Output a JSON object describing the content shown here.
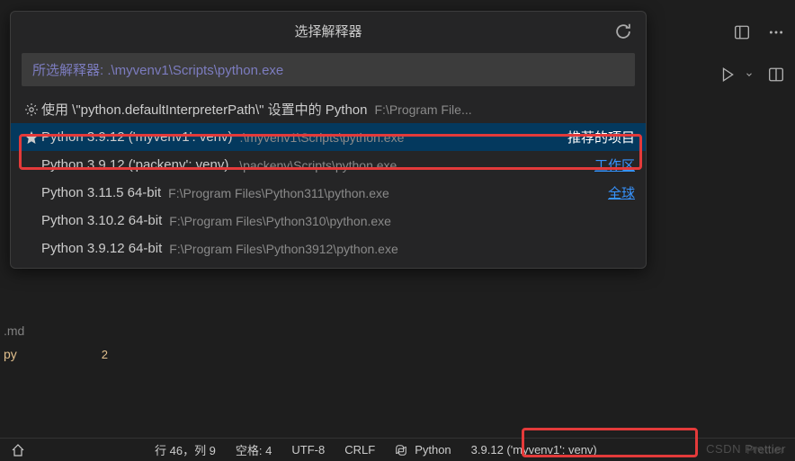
{
  "quickPick": {
    "title": "选择解释器",
    "inputValue": "所选解释器: .\\myvenv1\\Scripts\\python.exe",
    "items": [
      {
        "icon": "gear",
        "label": "使用 \\\"python.defaultInterpreterPath\\\" 设置中的 Python",
        "desc": "F:\\Program File...",
        "tag": "",
        "tagClass": ""
      },
      {
        "icon": "star",
        "label": "Python 3.9.12 ('myvenv1': venv)",
        "desc": ".\\myvenv1\\Scripts\\python.exe",
        "tag": "推荐的项目",
        "tagClass": "tag-white",
        "selected": true
      },
      {
        "icon": "none",
        "label": "Python 3.9.12 ('packenv': venv)",
        "desc": ".\\packenv\\Scripts\\python.exe",
        "tag": "工作区",
        "tagClass": "tag-link"
      },
      {
        "icon": "none",
        "label": "Python 3.11.5 64-bit",
        "desc": "F:\\Program Files\\Python311\\python.exe",
        "tag": "全球",
        "tagClass": "tag-link"
      },
      {
        "icon": "none",
        "label": "Python 3.10.2 64-bit",
        "desc": "F:\\Program Files\\Python310\\python.exe",
        "tag": "",
        "tagClass": ""
      },
      {
        "icon": "none",
        "label": "Python 3.9.12 64-bit",
        "desc": "F:\\Program Files\\Python3912\\python.exe",
        "tag": "",
        "tagClass": ""
      }
    ]
  },
  "sidebar": {
    "files": [
      {
        "ext": ".md",
        "class": "file-md",
        "badge": ""
      },
      {
        "ext": "py",
        "class": "file-py",
        "badge": "2"
      }
    ]
  },
  "statusBar": {
    "cursor": "行 46，列 9",
    "spaces": "空格: 4",
    "encoding": "UTF-8",
    "eol": "CRLF",
    "lang": "Python",
    "interpreter": "3.9.12 ('myvenv1': venv)",
    "prettier": "Prettier"
  },
  "watermark": "CSDN Prettier"
}
